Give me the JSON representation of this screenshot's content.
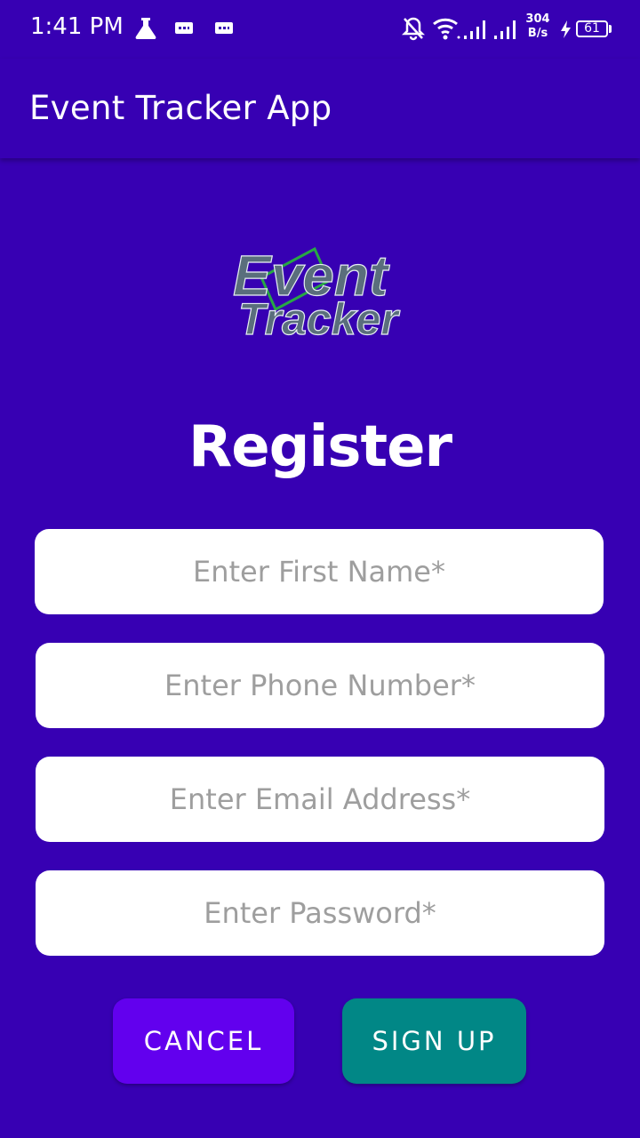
{
  "status_bar": {
    "time": "1:41 PM",
    "net_speed_value": "304",
    "net_speed_unit": "B/s",
    "battery": "61",
    "icons": [
      "flask-icon",
      "message-icon",
      "message-icon",
      "bell-off-icon",
      "wifi-icon",
      "signal-icon",
      "signal-icon",
      "charging-icon",
      "battery-icon"
    ]
  },
  "app_bar": {
    "title": "Event Tracker App"
  },
  "logo": {
    "line1": "Event",
    "line2": "Tracker"
  },
  "form": {
    "heading": "Register",
    "first_name_placeholder": "Enter First Name*",
    "phone_placeholder": "Enter Phone Number*",
    "email_placeholder": "Enter Email Address*",
    "password_placeholder": "Enter Password*"
  },
  "buttons": {
    "cancel": "CANCEL",
    "sign_up": "SIGN UP"
  },
  "colors": {
    "background": "#3700b3",
    "cancel_button": "#6200ee",
    "signup_button": "#018786",
    "logo_fill": "#5a6e7c",
    "logo_accent": "#28a745"
  }
}
